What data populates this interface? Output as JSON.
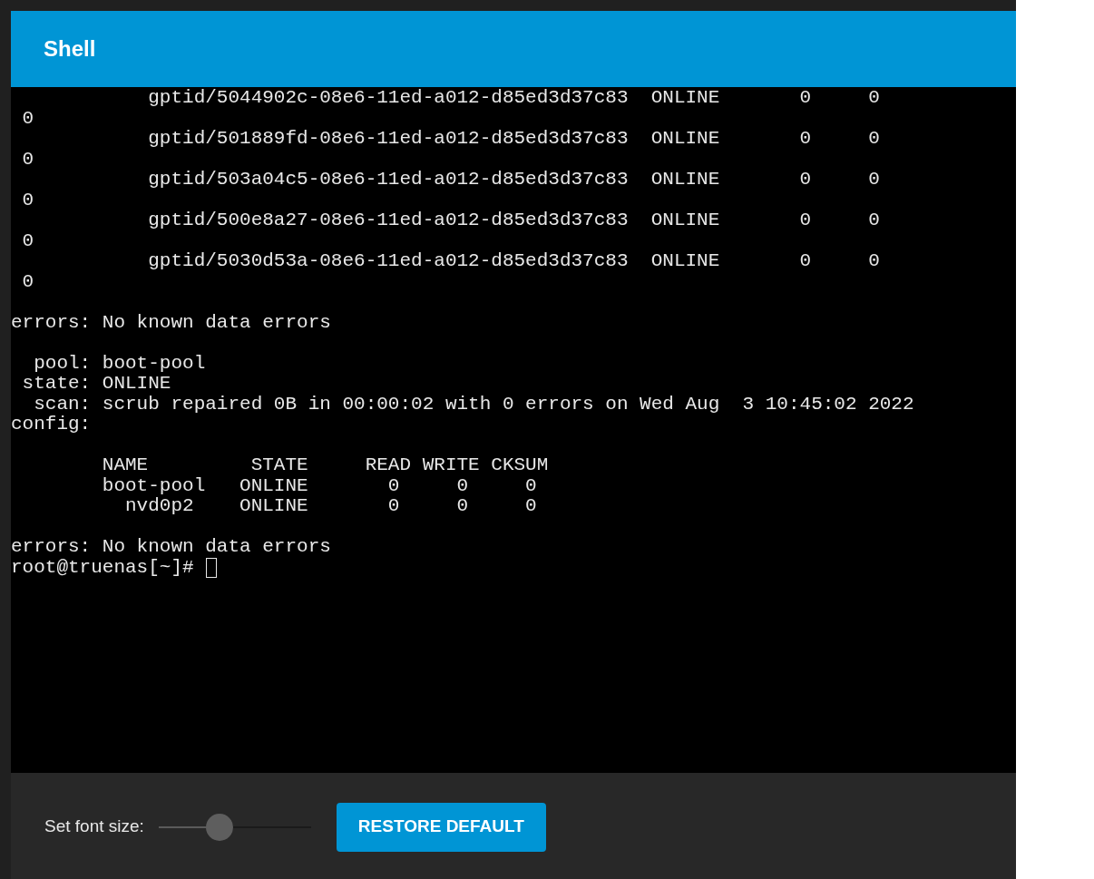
{
  "header": {
    "title": "Shell"
  },
  "terminal": {
    "blocks": [
      [
        "            gptid/5044902c-08e6-11ed-a012-d85ed3d37c83  ONLINE       0     0",
        " 0",
        "            gptid/501889fd-08e6-11ed-a012-d85ed3d37c83  ONLINE       0     0",
        " 0",
        "            gptid/503a04c5-08e6-11ed-a012-d85ed3d37c83  ONLINE       0     0",
        " 0",
        "            gptid/500e8a27-08e6-11ed-a012-d85ed3d37c83  ONLINE       0     0",
        " 0",
        "            gptid/5030d53a-08e6-11ed-a012-d85ed3d37c83  ONLINE       0     0",
        " 0"
      ],
      [
        "errors: No known data errors"
      ],
      [
        "  pool: boot-pool",
        " state: ONLINE",
        "  scan: scrub repaired 0B in 00:00:02 with 0 errors on Wed Aug  3 10:45:02 2022",
        "config:"
      ],
      [
        "        NAME         STATE     READ WRITE CKSUM",
        "        boot-pool   ONLINE       0     0     0",
        "          nvd0p2    ONLINE       0     0     0"
      ],
      [
        "errors: No known data errors",
        "root@truenas[~]#"
      ]
    ]
  },
  "footer": {
    "font_size_label": "Set font size:",
    "font_size": {
      "level": 0.4
    },
    "restore_button": "RESTORE DEFAULT"
  }
}
